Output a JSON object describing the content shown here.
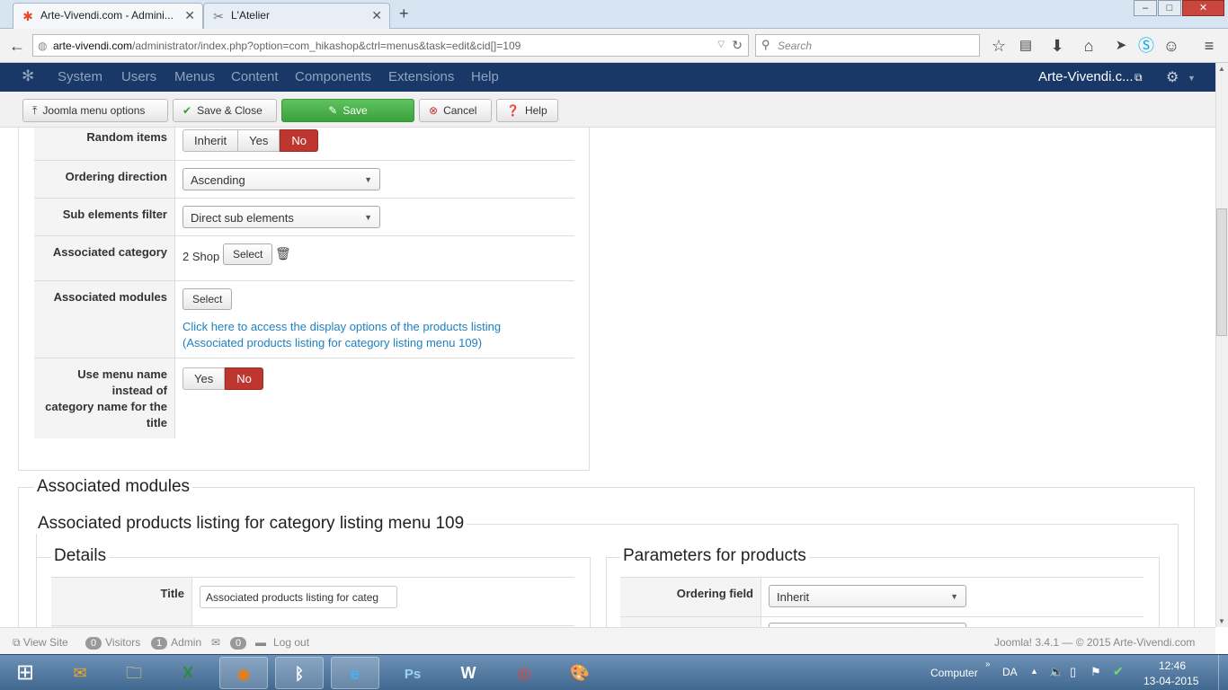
{
  "browser": {
    "tabs": [
      {
        "label": "Arte-Vivendi.com - Admini...",
        "active": true
      },
      {
        "label": "L'Atelier",
        "active": false
      }
    ],
    "url_domain": "arte-vivendi.com",
    "url_path": "/administrator/index.php?option=com_hikashop&ctrl=menus&task=edit&cid[]=109",
    "search_placeholder": "Search",
    "window_buttons": [
      "–",
      "□",
      "✕"
    ]
  },
  "joomla_nav": {
    "items": [
      "System",
      "Users",
      "Menus",
      "Content",
      "Components",
      "Extensions",
      "Help"
    ],
    "site_link": "Arte-Vivendi.c..."
  },
  "toolbar": {
    "options_label": "Joomla menu options",
    "save_close_label": "Save & Close",
    "save_label": "Save",
    "cancel_label": "Cancel",
    "help_label": "Help"
  },
  "form": {
    "random_items": {
      "label": "Random items",
      "options": [
        "Inherit",
        "Yes",
        "No"
      ],
      "selected": "No"
    },
    "ordering_direction": {
      "label": "Ordering direction",
      "value": "Ascending"
    },
    "sub_elements_filter": {
      "label": "Sub elements filter",
      "value": "Direct sub elements"
    },
    "associated_category": {
      "label": "Associated category",
      "value": "2 Shop",
      "button": "Select"
    },
    "associated_modules": {
      "label": "Associated modules",
      "button": "Select",
      "link_line1": "Click here to access the display options of the products listing",
      "link_line2": "(Associated products listing for category listing menu 109)"
    },
    "use_menu_name": {
      "label_lines": [
        "Use menu name",
        "instead of",
        "category name for the",
        "title"
      ],
      "options": [
        "Yes",
        "No"
      ],
      "selected": "No"
    }
  },
  "modules_section": {
    "legend": "Associated modules",
    "inner_legend": "Associated products listing for category listing menu 109",
    "details": {
      "legend": "Details",
      "title_label": "Title",
      "title_value": "Associated products listing for categ"
    },
    "parameters": {
      "legend": "Parameters for products",
      "ordering_field_label": "Ordering field",
      "ordering_field_value": "Inherit"
    }
  },
  "statusbar": {
    "view_site": "View Site",
    "visitors_count": "0",
    "visitors_label": "Visitors",
    "admin_count": "1",
    "admin_label": "Admin",
    "messages_count": "0",
    "logout": "Log out",
    "copyright": "Joomla! 3.4.1 — © 2015 Arte-Vivendi.com"
  },
  "taskbar": {
    "computer_label": "Computer",
    "lang": "DA",
    "time": "12:46",
    "date": "13-04-2015"
  },
  "colors": {
    "joomla_nav_bg": "#1a3867",
    "danger": "#bd362f",
    "success": "#4cae4c",
    "link": "#1e80c2"
  }
}
